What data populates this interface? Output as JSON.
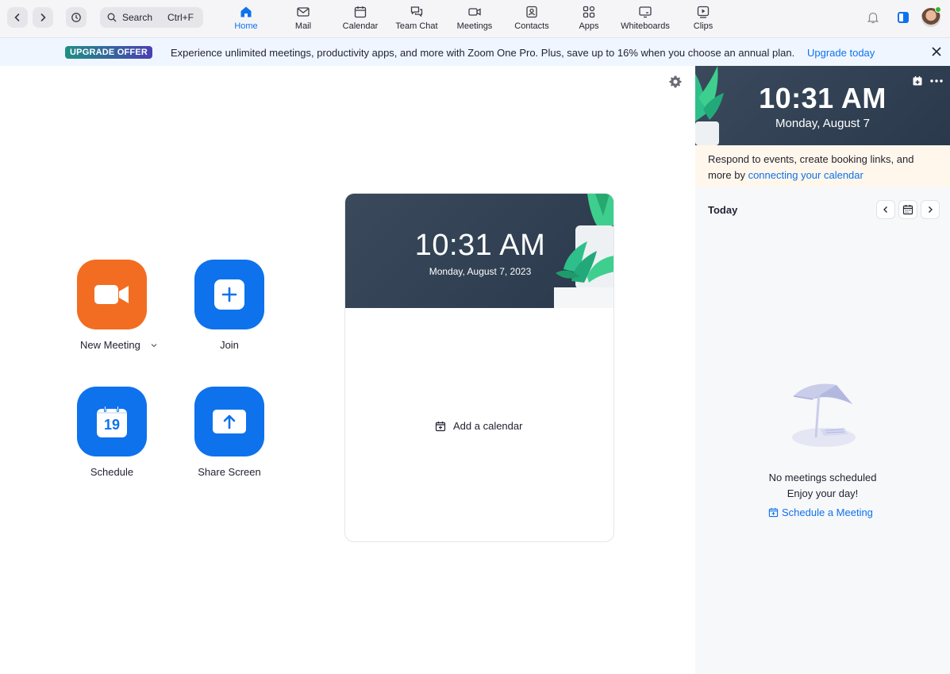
{
  "topbar": {
    "search": {
      "label": "Search",
      "shortcut": "Ctrl+F"
    },
    "tabs": [
      {
        "label": "Home",
        "icon": "home-icon"
      },
      {
        "label": "Mail",
        "icon": "mail-icon"
      },
      {
        "label": "Calendar",
        "icon": "calendar-icon"
      },
      {
        "label": "Team Chat",
        "icon": "chat-icon"
      },
      {
        "label": "Meetings",
        "icon": "video-icon"
      },
      {
        "label": "Contacts",
        "icon": "contacts-icon"
      },
      {
        "label": "Apps",
        "icon": "apps-icon"
      },
      {
        "label": "Whiteboards",
        "icon": "whiteboard-icon"
      },
      {
        "label": "Clips",
        "icon": "clips-icon"
      }
    ],
    "active_tab": "Home"
  },
  "banner": {
    "badge": "UPGRADE OFFER",
    "text": "Experience unlimited meetings, productivity apps, and more with Zoom One Pro. Plus, save up to 16% when you choose an annual plan.",
    "link": "Upgrade today"
  },
  "actions": {
    "new_meeting": "New Meeting",
    "join": "Join",
    "schedule": "Schedule",
    "schedule_day": "19",
    "share_screen": "Share Screen"
  },
  "calendar_card": {
    "time": "10:31 AM",
    "date": "Monday, August 7, 2023",
    "add_calendar": "Add a calendar"
  },
  "right_panel": {
    "time": "10:31 AM",
    "date": "Monday, August 7",
    "notice_prefix": "Respond to events, create booking links, and more by ",
    "notice_link": "connecting your calendar",
    "today": "Today",
    "empty_title": "No meetings scheduled",
    "empty_sub": "Enjoy your day!",
    "schedule_link": "Schedule a Meeting"
  },
  "colors": {
    "accent": "#0e72ed",
    "new_meeting": "#f26d21",
    "status_online": "#2eb82e"
  }
}
